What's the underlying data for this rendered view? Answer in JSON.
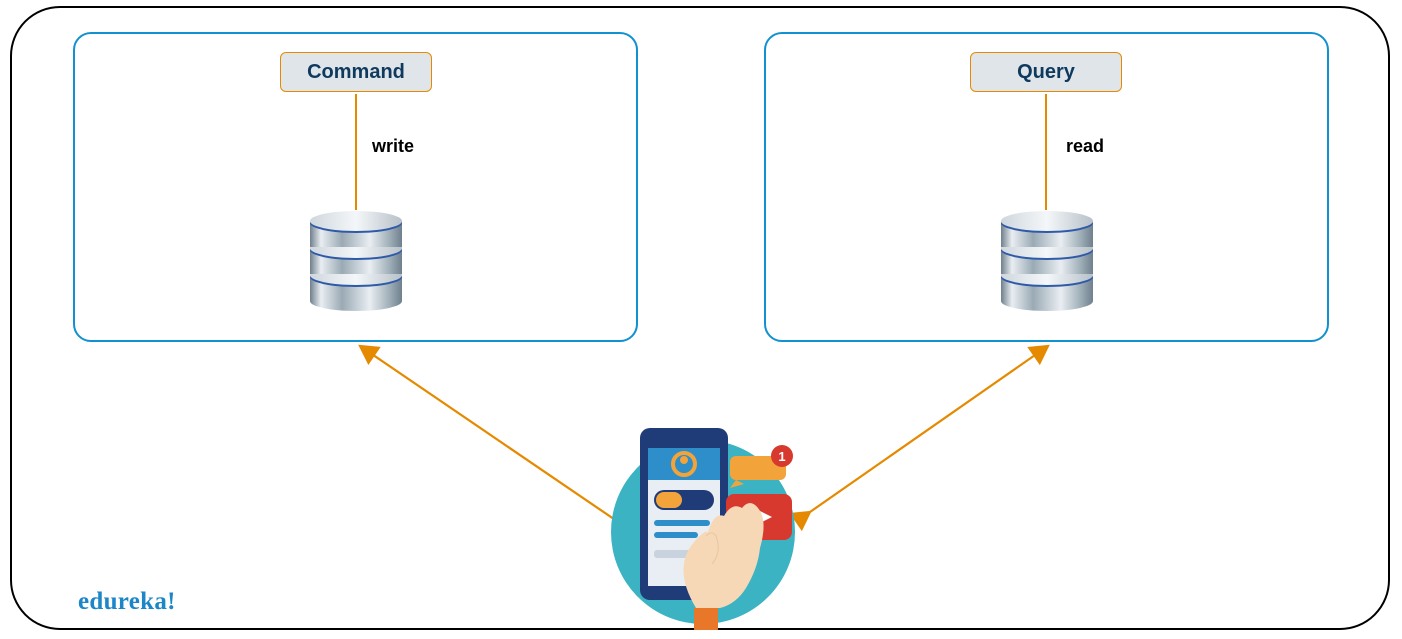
{
  "diagram": {
    "left_node_label": "Command",
    "right_node_label": "Query",
    "left_operation": "write",
    "right_operation": "read"
  },
  "brand": "edureka!",
  "colors": {
    "panel_border": "#1191cf",
    "accent_orange": "#e58a00",
    "label_bg": "#e0e5ea",
    "label_text": "#0f3a5e",
    "brand_blue": "#1c86c8"
  }
}
